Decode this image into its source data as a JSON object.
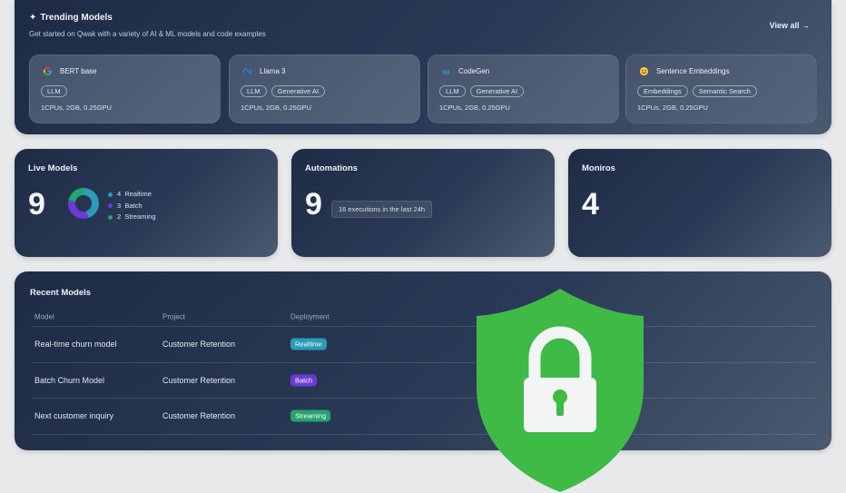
{
  "trending": {
    "title": "Trending Models",
    "subtitle": "Get started on Qwak with a variety of AI & ML models and code examples",
    "view_all": "View all →",
    "models": [
      {
        "name": "BERT base",
        "icon": "google-icon",
        "tags": [
          "LLM"
        ],
        "spec": "1CPUs, 2GB, 0.25GPU"
      },
      {
        "name": "Llama 3",
        "icon": "meta-icon",
        "tags": [
          "LLM",
          "Generative AI"
        ],
        "spec": "1CPUs, 2GB, 0.25GPU"
      },
      {
        "name": "CodeGen",
        "icon": "infinity-icon",
        "tags": [
          "LLM",
          "Generative AI"
        ],
        "spec": "1CPUs, 2GB, 0.25GPU"
      },
      {
        "name": "Sentence Embeddings",
        "icon": "hugging-face-icon",
        "tags": [
          "Embeddings",
          "Semantic Search"
        ],
        "spec": "1CPUs, 2GB, 0.25GPU"
      }
    ]
  },
  "live_models": {
    "title": "Live Models",
    "count": "9",
    "legend": [
      {
        "value": "4",
        "label": "Realtime",
        "color": "#2a9cb5"
      },
      {
        "value": "3",
        "label": "Batch",
        "color": "#6c3bd6"
      },
      {
        "value": "2",
        "label": "Streaming",
        "color": "#25a36f"
      }
    ],
    "breakdown": [
      4,
      3,
      2
    ]
  },
  "automations": {
    "title": "Automations",
    "count": "9",
    "executions": "16 executions in the last 24h"
  },
  "monitors": {
    "title": "Moniros",
    "count": "4"
  },
  "recent": {
    "title": "Recent Models",
    "columns": [
      "Model",
      "Project",
      "Deployment"
    ],
    "rows": [
      {
        "model": "Real-time churn model",
        "project": "Customer Retention",
        "deployment": "Realtime"
      },
      {
        "model": "Batch Churn Model",
        "project": "Customer Retention",
        "deployment": "Batch"
      },
      {
        "model": "Next customer inquiry",
        "project": "Customer Retention",
        "deployment": "Streaming"
      }
    ]
  },
  "colors": {
    "realtime": "#2a9cb5",
    "batch": "#6c3bd6",
    "streaming": "#25a36f",
    "shield": "#3fba47"
  }
}
